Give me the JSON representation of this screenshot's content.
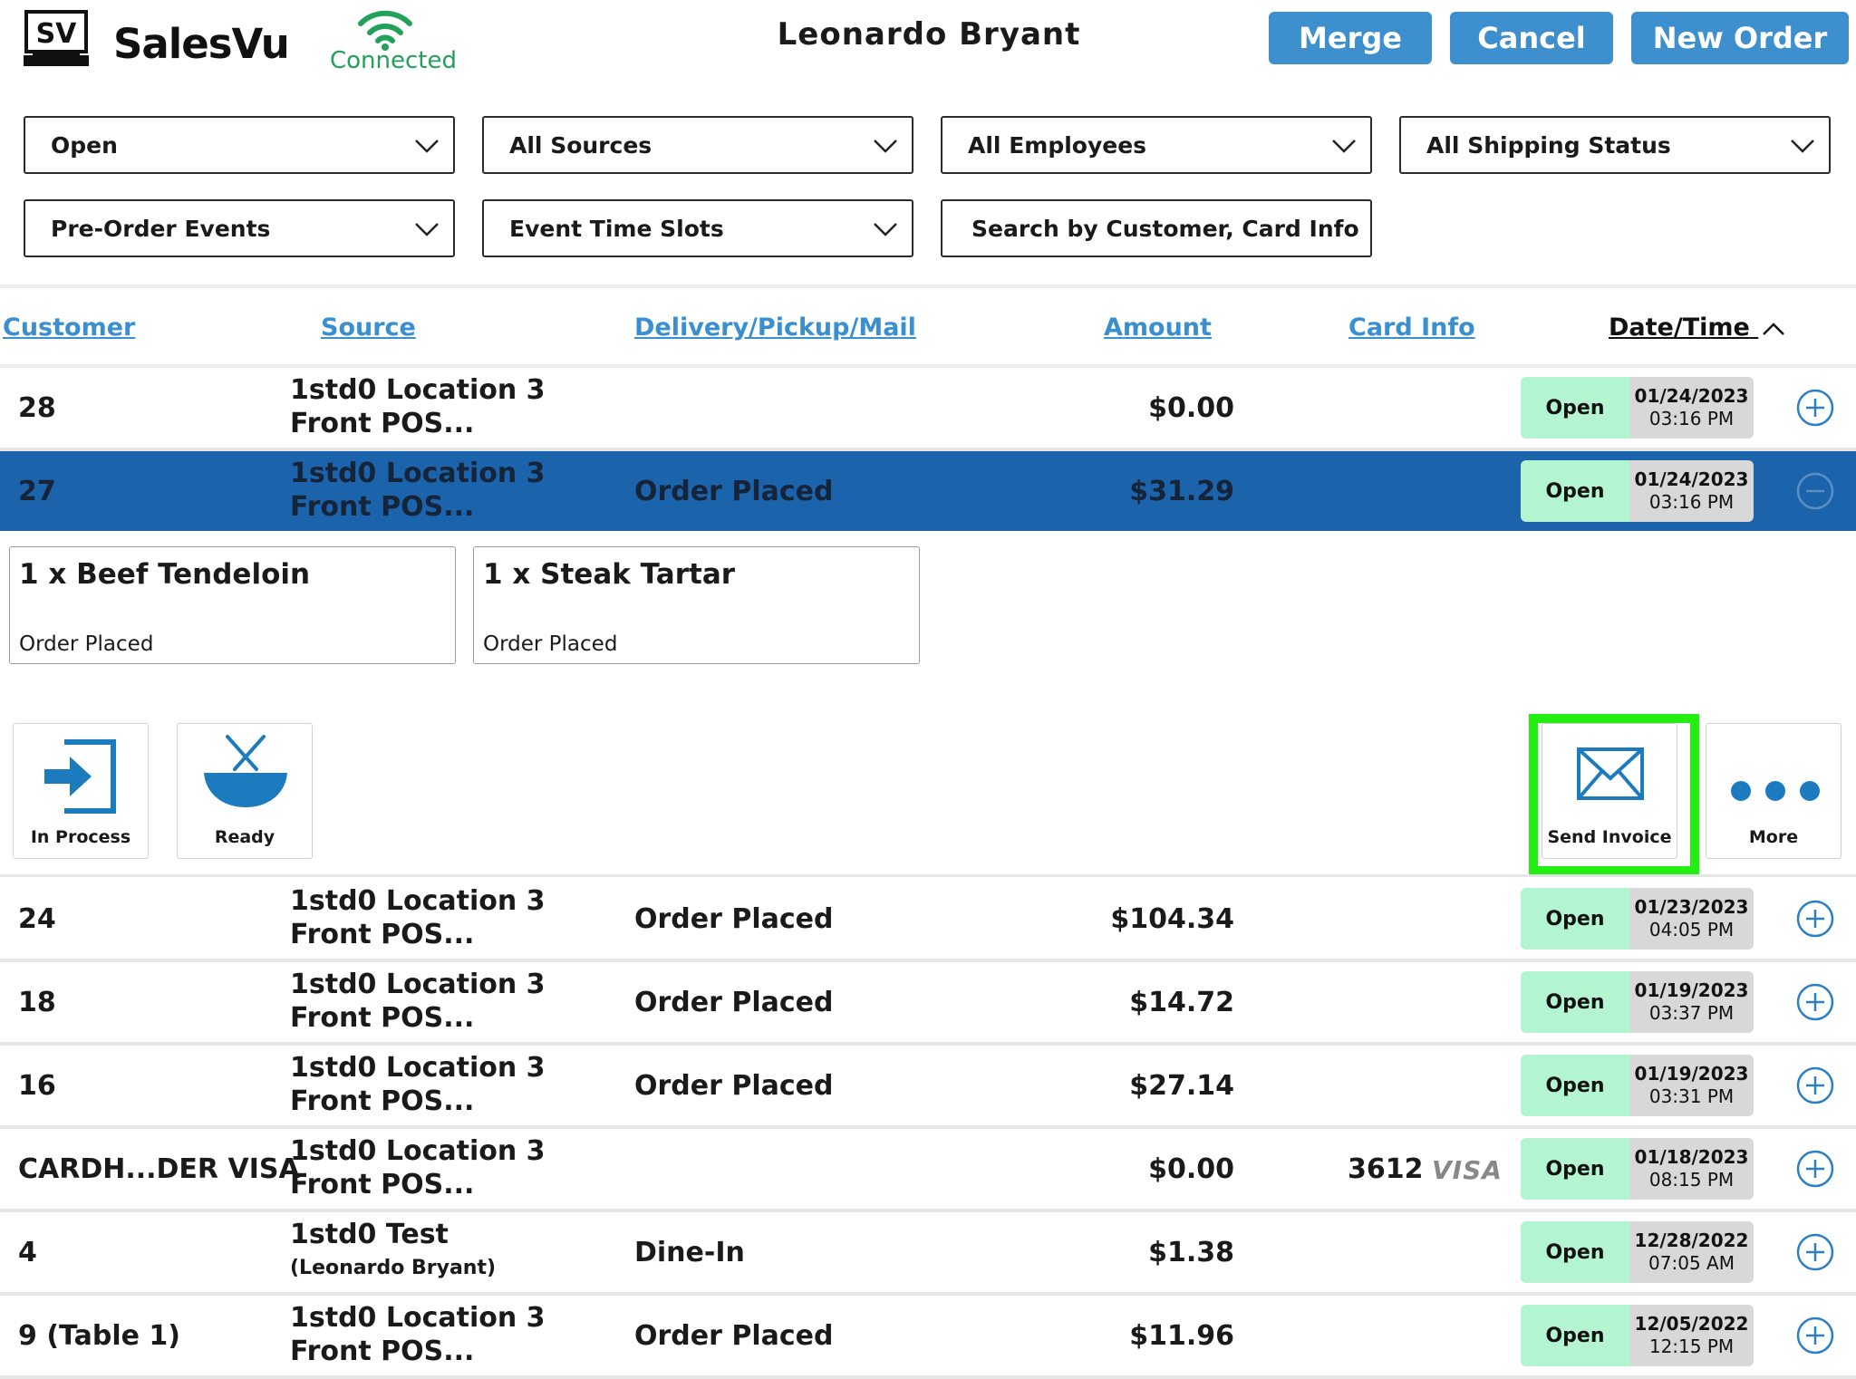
{
  "header": {
    "logo_text": "SV",
    "brand": "SalesVu",
    "connection_status": "Connected",
    "user_name": "Leonardo Bryant",
    "buttons": {
      "merge": "Merge",
      "cancel": "Cancel",
      "new_order": "New Order"
    }
  },
  "filters": {
    "status": "Open",
    "sources": "All Sources",
    "employees": "All Employees",
    "shipping": "All Shipping Status",
    "pre_order": "Pre-Order Events",
    "time_slots": "Event Time Slots",
    "search_placeholder": "Search by Customer, Card Info"
  },
  "columns": {
    "customer": "Customer",
    "source": "Source",
    "delivery": "Delivery/Pickup/Mail",
    "amount": "Amount",
    "card_info": "Card Info",
    "datetime": "Date/Time"
  },
  "orders": [
    {
      "customer": "28",
      "source1": "1std0 Location 3",
      "source2": "Front POS...",
      "delivery": "",
      "amount": "$0.00",
      "card": "",
      "card_brand": "",
      "status": "Open",
      "date": "01/24/2023",
      "time": "03:16 PM"
    },
    {
      "customer": "27",
      "source1": "1std0 Location 3",
      "source2": "Front POS...",
      "delivery": "Order Placed",
      "amount": "$31.29",
      "card": "",
      "card_brand": "",
      "status": "Open",
      "date": "01/24/2023",
      "time": "03:16 PM"
    },
    {
      "customer": "24",
      "source1": "1std0 Location 3",
      "source2": "Front POS...",
      "delivery": "Order Placed",
      "amount": "$104.34",
      "card": "",
      "card_brand": "",
      "status": "Open",
      "date": "01/23/2023",
      "time": "04:05 PM"
    },
    {
      "customer": "18",
      "source1": "1std0 Location 3",
      "source2": "Front POS...",
      "delivery": "Order Placed",
      "amount": "$14.72",
      "card": "",
      "card_brand": "",
      "status": "Open",
      "date": "01/19/2023",
      "time": "03:37 PM"
    },
    {
      "customer": "16",
      "source1": "1std0 Location 3",
      "source2": "Front POS...",
      "delivery": "Order Placed",
      "amount": "$27.14",
      "card": "",
      "card_brand": "",
      "status": "Open",
      "date": "01/19/2023",
      "time": "03:31 PM"
    },
    {
      "customer": "CARDH...DER VISA",
      "source1": "1std0 Location 3",
      "source2": "Front POS...",
      "delivery": "",
      "amount": "$0.00",
      "card": "3612",
      "card_brand": "VISA",
      "status": "Open",
      "date": "01/18/2023",
      "time": "08:15 PM"
    },
    {
      "customer": "4",
      "source1": "1std0 Test",
      "source2": "(Leonardo  Bryant)",
      "delivery": "Dine-In",
      "amount": "$1.38",
      "card": "",
      "card_brand": "",
      "status": "Open",
      "date": "12/28/2022",
      "time": "07:05 AM"
    },
    {
      "customer": "9 (Table 1)",
      "source1": "1std0 Location 3",
      "source2": "Front POS...",
      "delivery": "Order Placed",
      "amount": "$11.96",
      "card": "",
      "card_brand": "",
      "status": "Open",
      "date": "12/05/2022",
      "time": "12:15 PM"
    }
  ],
  "expanded": {
    "items": [
      {
        "name": "1 x Beef Tendeloin",
        "status": "Order Placed"
      },
      {
        "name": "1 x Steak Tartar",
        "status": "Order Placed"
      }
    ],
    "actions": {
      "in_process": "In Process",
      "ready": "Ready",
      "send_invoice": "Send Invoice",
      "more": "More"
    }
  },
  "colors": {
    "accent": "#3d8fcd",
    "selected_row": "#1b63aa",
    "status_open": "#b3f5d0",
    "connected": "#22a15a",
    "highlight": "#22ee11"
  }
}
